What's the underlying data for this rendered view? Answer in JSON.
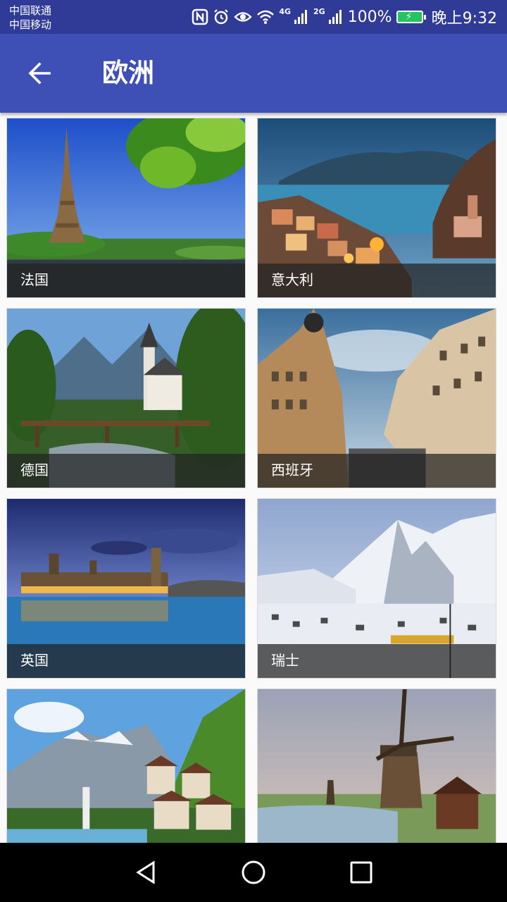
{
  "status_bar": {
    "carrier_1": "中国联通",
    "carrier_2": "中国移动",
    "network_1": "4G",
    "network_2": "2G",
    "battery": "100%",
    "time": "晚上9:32",
    "battery_color": "#22c55e"
  },
  "app_bar": {
    "title": "欧洲",
    "back_icon": "arrow-left-icon",
    "color": "#3e4fb5"
  },
  "countries": [
    {
      "label": "法国",
      "scene": "eiffel-tower"
    },
    {
      "label": "意大利",
      "scene": "coastal-village"
    },
    {
      "label": "德国",
      "scene": "alpine-church"
    },
    {
      "label": "西班牙",
      "scene": "madrid-building"
    },
    {
      "label": "英国",
      "scene": "parliament"
    },
    {
      "label": "瑞士",
      "scene": "snowy-village"
    },
    {
      "label": "",
      "scene": "lake-village"
    },
    {
      "label": "",
      "scene": "windmill"
    }
  ],
  "nav_bar": {
    "back": "triangle-back-icon",
    "home": "circle-home-icon",
    "recents": "square-recents-icon"
  }
}
